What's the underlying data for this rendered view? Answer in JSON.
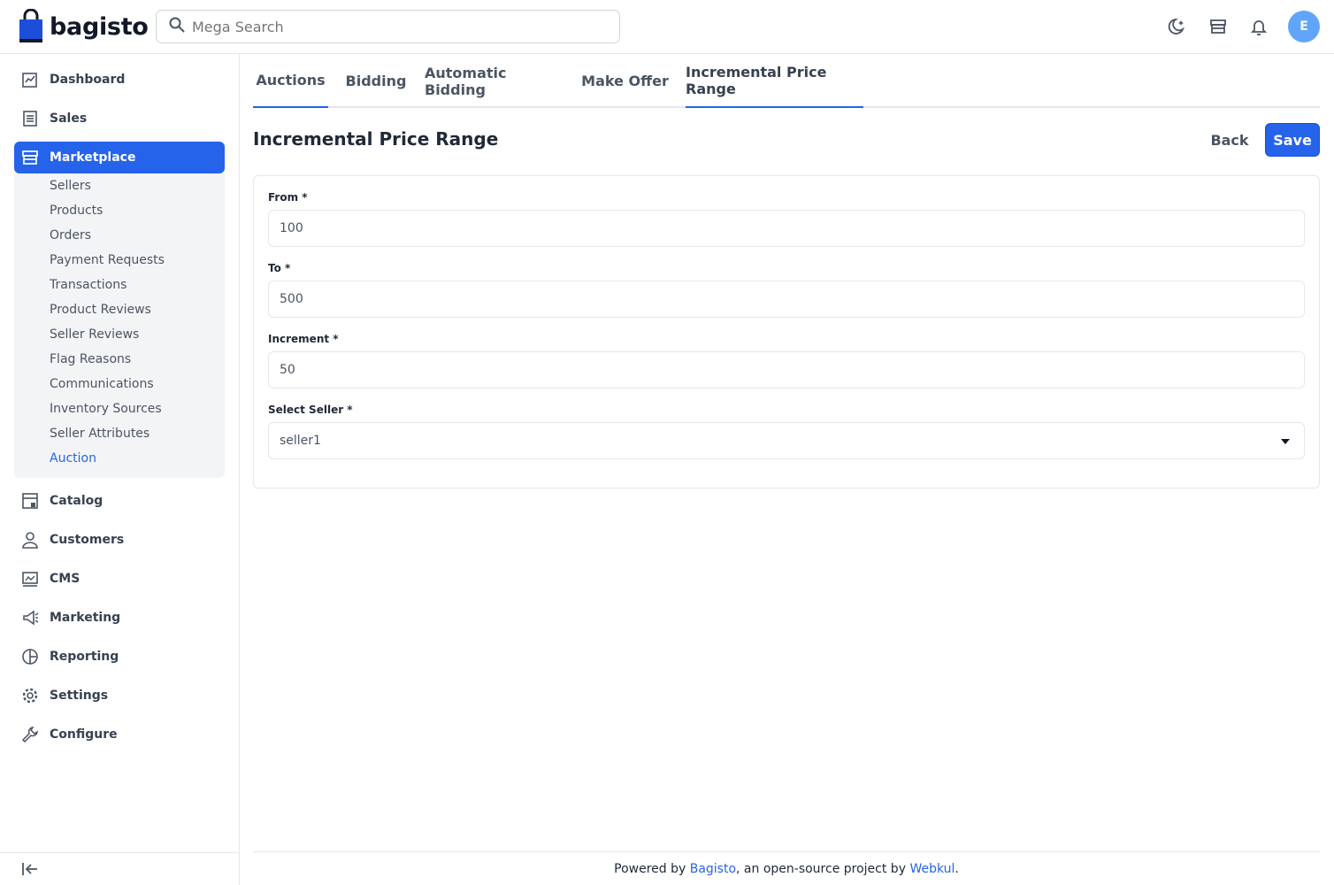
{
  "brand": {
    "name": "bagisto",
    "color": "#2563eb"
  },
  "search": {
    "placeholder": "Mega Search"
  },
  "header_icons": [
    "moon-icon",
    "store-icon",
    "bell-icon"
  ],
  "user": {
    "initial": "E"
  },
  "sidebar": {
    "items": [
      {
        "label": "Dashboard",
        "icon": "dashboard-icon"
      },
      {
        "label": "Sales",
        "icon": "sales-icon"
      },
      {
        "label": "Marketplace",
        "icon": "store-icon",
        "active": true
      },
      {
        "label": "Catalog",
        "icon": "catalog-icon"
      },
      {
        "label": "Customers",
        "icon": "customers-icon"
      },
      {
        "label": "CMS",
        "icon": "cms-icon"
      },
      {
        "label": "Marketing",
        "icon": "marketing-icon"
      },
      {
        "label": "Reporting",
        "icon": "reporting-icon"
      },
      {
        "label": "Settings",
        "icon": "settings-icon"
      },
      {
        "label": "Configure",
        "icon": "configure-icon"
      }
    ],
    "submenu": [
      "Sellers",
      "Products",
      "Orders",
      "Payment Requests",
      "Transactions",
      "Product Reviews",
      "Seller Reviews",
      "Flag Reasons",
      "Communications",
      "Inventory Sources",
      "Seller Attributes",
      "Auction"
    ],
    "active_submenu": "Auction"
  },
  "tabs": [
    {
      "label": "Auctions"
    },
    {
      "label": "Bidding"
    },
    {
      "label": "Automatic Bidding"
    },
    {
      "label": "Make Offer"
    },
    {
      "label": "Incremental Price Range"
    }
  ],
  "page": {
    "title": "Incremental Price Range",
    "back_label": "Back",
    "save_label": "Save"
  },
  "form": {
    "from": {
      "label": "From *",
      "value": "100"
    },
    "to": {
      "label": "To *",
      "value": "500"
    },
    "increment": {
      "label": "Increment *",
      "value": "50"
    },
    "seller": {
      "label": "Select Seller *",
      "value": "seller1"
    }
  },
  "footer": {
    "prefix": "Powered by ",
    "link1": "Bagisto",
    "middle": ", an open-source project by ",
    "link2": "Webkul",
    "suffix": "."
  }
}
